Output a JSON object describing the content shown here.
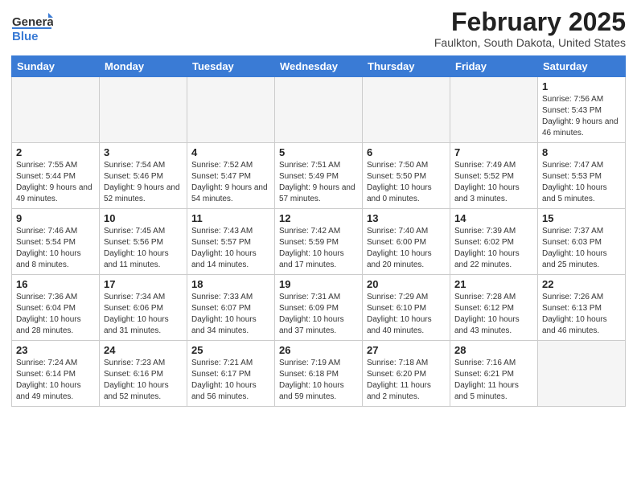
{
  "header": {
    "logo_general": "General",
    "logo_blue": "Blue",
    "title": "February 2025",
    "location": "Faulkton, South Dakota, United States"
  },
  "days_of_week": [
    "Sunday",
    "Monday",
    "Tuesday",
    "Wednesday",
    "Thursday",
    "Friday",
    "Saturday"
  ],
  "weeks": [
    [
      {
        "day": "",
        "info": ""
      },
      {
        "day": "",
        "info": ""
      },
      {
        "day": "",
        "info": ""
      },
      {
        "day": "",
        "info": ""
      },
      {
        "day": "",
        "info": ""
      },
      {
        "day": "",
        "info": ""
      },
      {
        "day": "1",
        "info": "Sunrise: 7:56 AM\nSunset: 5:43 PM\nDaylight: 9 hours and 46 minutes."
      }
    ],
    [
      {
        "day": "2",
        "info": "Sunrise: 7:55 AM\nSunset: 5:44 PM\nDaylight: 9 hours and 49 minutes."
      },
      {
        "day": "3",
        "info": "Sunrise: 7:54 AM\nSunset: 5:46 PM\nDaylight: 9 hours and 52 minutes."
      },
      {
        "day": "4",
        "info": "Sunrise: 7:52 AM\nSunset: 5:47 PM\nDaylight: 9 hours and 54 minutes."
      },
      {
        "day": "5",
        "info": "Sunrise: 7:51 AM\nSunset: 5:49 PM\nDaylight: 9 hours and 57 minutes."
      },
      {
        "day": "6",
        "info": "Sunrise: 7:50 AM\nSunset: 5:50 PM\nDaylight: 10 hours and 0 minutes."
      },
      {
        "day": "7",
        "info": "Sunrise: 7:49 AM\nSunset: 5:52 PM\nDaylight: 10 hours and 3 minutes."
      },
      {
        "day": "8",
        "info": "Sunrise: 7:47 AM\nSunset: 5:53 PM\nDaylight: 10 hours and 5 minutes."
      }
    ],
    [
      {
        "day": "9",
        "info": "Sunrise: 7:46 AM\nSunset: 5:54 PM\nDaylight: 10 hours and 8 minutes."
      },
      {
        "day": "10",
        "info": "Sunrise: 7:45 AM\nSunset: 5:56 PM\nDaylight: 10 hours and 11 minutes."
      },
      {
        "day": "11",
        "info": "Sunrise: 7:43 AM\nSunset: 5:57 PM\nDaylight: 10 hours and 14 minutes."
      },
      {
        "day": "12",
        "info": "Sunrise: 7:42 AM\nSunset: 5:59 PM\nDaylight: 10 hours and 17 minutes."
      },
      {
        "day": "13",
        "info": "Sunrise: 7:40 AM\nSunset: 6:00 PM\nDaylight: 10 hours and 20 minutes."
      },
      {
        "day": "14",
        "info": "Sunrise: 7:39 AM\nSunset: 6:02 PM\nDaylight: 10 hours and 22 minutes."
      },
      {
        "day": "15",
        "info": "Sunrise: 7:37 AM\nSunset: 6:03 PM\nDaylight: 10 hours and 25 minutes."
      }
    ],
    [
      {
        "day": "16",
        "info": "Sunrise: 7:36 AM\nSunset: 6:04 PM\nDaylight: 10 hours and 28 minutes."
      },
      {
        "day": "17",
        "info": "Sunrise: 7:34 AM\nSunset: 6:06 PM\nDaylight: 10 hours and 31 minutes."
      },
      {
        "day": "18",
        "info": "Sunrise: 7:33 AM\nSunset: 6:07 PM\nDaylight: 10 hours and 34 minutes."
      },
      {
        "day": "19",
        "info": "Sunrise: 7:31 AM\nSunset: 6:09 PM\nDaylight: 10 hours and 37 minutes."
      },
      {
        "day": "20",
        "info": "Sunrise: 7:29 AM\nSunset: 6:10 PM\nDaylight: 10 hours and 40 minutes."
      },
      {
        "day": "21",
        "info": "Sunrise: 7:28 AM\nSunset: 6:12 PM\nDaylight: 10 hours and 43 minutes."
      },
      {
        "day": "22",
        "info": "Sunrise: 7:26 AM\nSunset: 6:13 PM\nDaylight: 10 hours and 46 minutes."
      }
    ],
    [
      {
        "day": "23",
        "info": "Sunrise: 7:24 AM\nSunset: 6:14 PM\nDaylight: 10 hours and 49 minutes."
      },
      {
        "day": "24",
        "info": "Sunrise: 7:23 AM\nSunset: 6:16 PM\nDaylight: 10 hours and 52 minutes."
      },
      {
        "day": "25",
        "info": "Sunrise: 7:21 AM\nSunset: 6:17 PM\nDaylight: 10 hours and 56 minutes."
      },
      {
        "day": "26",
        "info": "Sunrise: 7:19 AM\nSunset: 6:18 PM\nDaylight: 10 hours and 59 minutes."
      },
      {
        "day": "27",
        "info": "Sunrise: 7:18 AM\nSunset: 6:20 PM\nDaylight: 11 hours and 2 minutes."
      },
      {
        "day": "28",
        "info": "Sunrise: 7:16 AM\nSunset: 6:21 PM\nDaylight: 11 hours and 5 minutes."
      },
      {
        "day": "",
        "info": ""
      }
    ]
  ]
}
